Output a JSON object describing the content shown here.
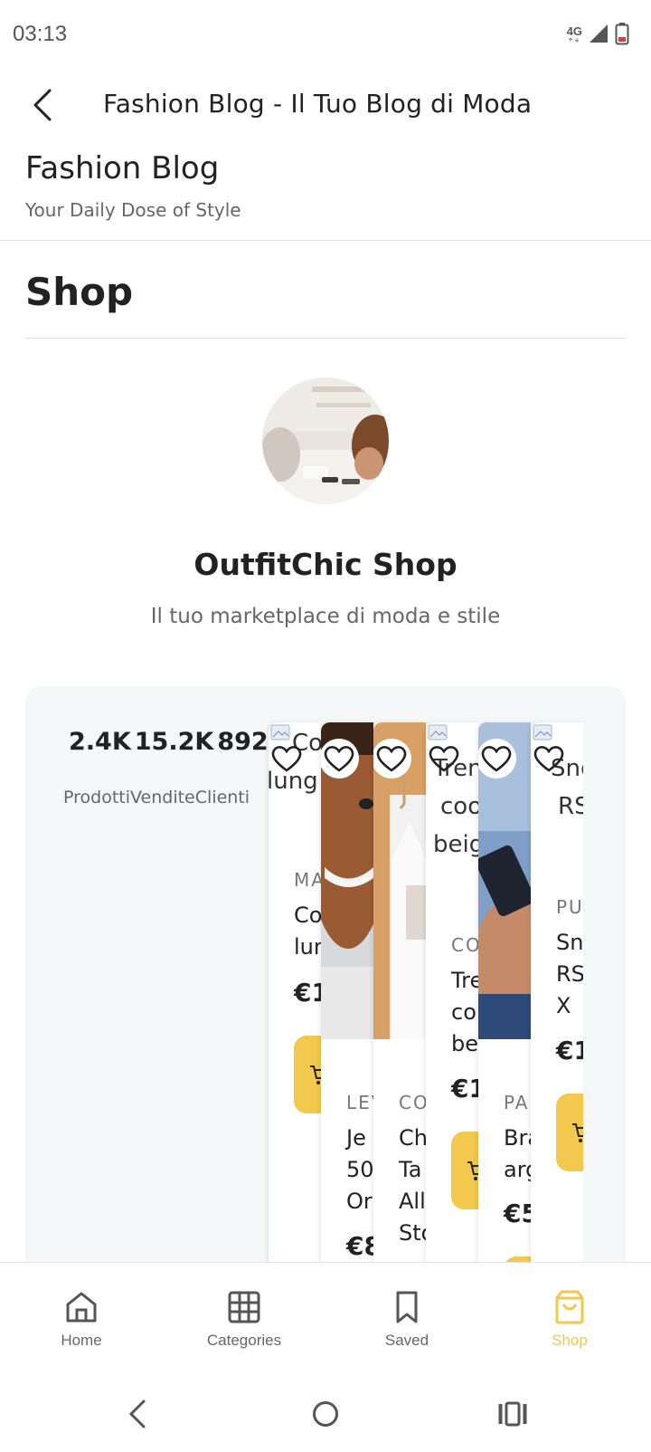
{
  "status_bar": {
    "time": "03:13",
    "network": "4G"
  },
  "app_bar": {
    "title": "Fashion Blog - Il Tuo Blog di Moda"
  },
  "blog": {
    "title": "Fashion Blog",
    "tagline": "Your Daily Dose of Style"
  },
  "section": {
    "title": "Shop"
  },
  "shop": {
    "name": "OutfitChic Shop",
    "description": "Il tuo marketplace di moda e stile"
  },
  "stats": [
    {
      "value": "2.4K",
      "label": "Prodotti"
    },
    {
      "value": "15.2K",
      "label": "Vendite"
    },
    {
      "value": "892",
      "label": "Clienti"
    }
  ],
  "products": [
    {
      "image_alt": [
        "Co",
        "lung"
      ],
      "brand": "MA",
      "name": [
        "Co",
        "lun"
      ],
      "price": "€1",
      "image": "broken"
    },
    {
      "brand": "LEV",
      "name": [
        "Je",
        "50",
        "Or"
      ],
      "price": "€8",
      "image": "man-smiling"
    },
    {
      "brand": "CO",
      "name": [
        "Ch",
        "Ta",
        "All",
        "Sto"
      ],
      "price": "",
      "image": "clothes-rack"
    },
    {
      "image_alt": [
        "Tren",
        "coo",
        "beig"
      ],
      "brand": "CO",
      "name": [
        "Tre",
        "co",
        "be"
      ],
      "price": "€1",
      "image": "broken"
    },
    {
      "brand": "PA",
      "name": [
        "Bra",
        "arg"
      ],
      "price": "€5",
      "image": "hand-phone"
    },
    {
      "image_alt": [
        "Sne",
        "RS"
      ],
      "brand": "PUI",
      "name": [
        "Sn",
        "RS",
        "X"
      ],
      "price": "€1",
      "image": "broken"
    }
  ],
  "bottom_nav": [
    {
      "label": "Home",
      "icon": "home-icon",
      "active": false
    },
    {
      "label": "Categories",
      "icon": "grid-icon",
      "active": false
    },
    {
      "label": "Saved",
      "icon": "bookmark-icon",
      "active": false
    },
    {
      "label": "Shop",
      "icon": "shopping-bag-icon",
      "active": true
    }
  ],
  "colors": {
    "accent": "#f2c94c",
    "panel_bg": "#f4f6f8",
    "text": "#222222",
    "muted": "#666666"
  }
}
